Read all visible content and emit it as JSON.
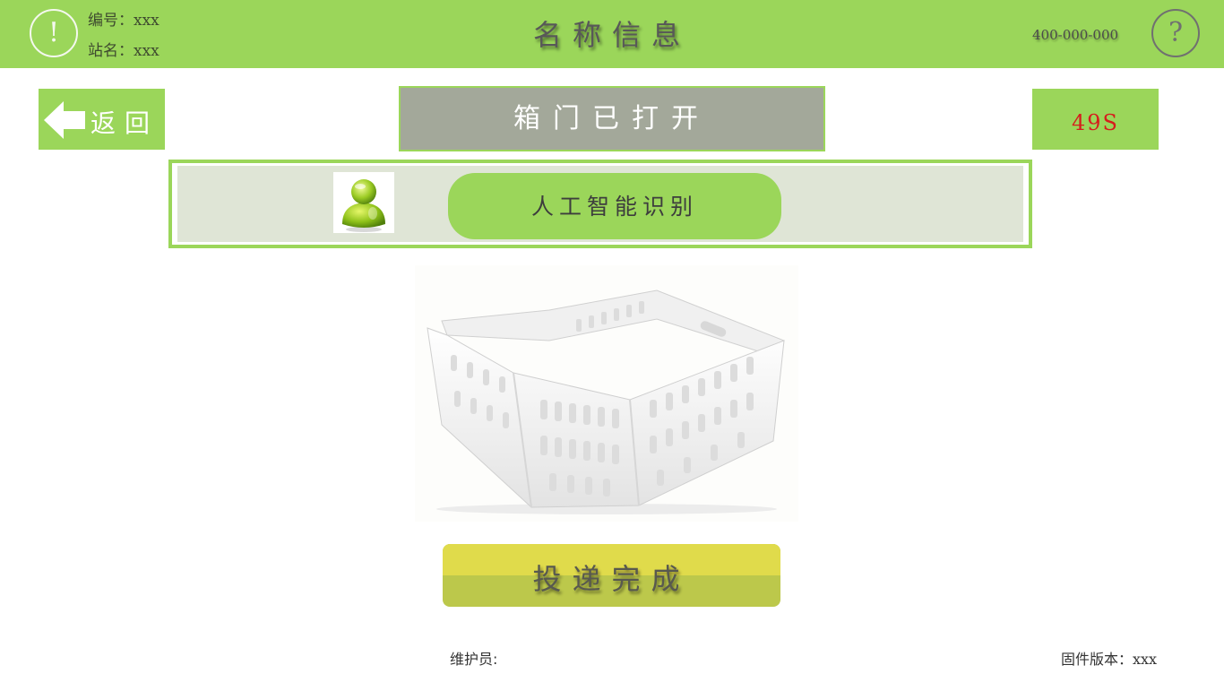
{
  "header": {
    "title": "名称信息",
    "station_number": "编号：xxx",
    "station_name": "站名：xxx",
    "phone": "400-000-000",
    "warning_glyph": "!",
    "help_glyph": "?"
  },
  "back_button": {
    "label": "返回"
  },
  "door_status": "箱门已打开",
  "countdown": "49S",
  "ai_panel": {
    "button_label": "人工智能识别"
  },
  "main_action": {
    "label": "投递完成"
  },
  "footer": {
    "maintainer": "维护员:",
    "firmware": "固件版本：xxx"
  },
  "icons": {
    "warning": "exclamation-circle-icon",
    "help": "question-circle-icon",
    "back": "arrow-left-icon",
    "avatar": "user-avatar-icon"
  },
  "colors": {
    "accent_green": "#9bd65a",
    "status_gray": "#a3a89a",
    "countdown_red": "#d61d1d",
    "action_yellow": "#e0db4b",
    "action_olive": "#bcc84b",
    "panel_bg": "#dfe5d6"
  }
}
